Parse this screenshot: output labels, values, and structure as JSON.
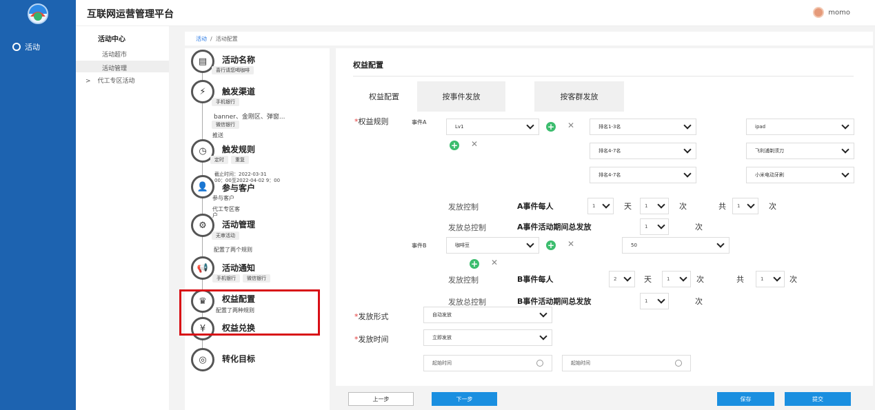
{
  "app": {
    "title": "互联网运营管理平台",
    "user": "momo"
  },
  "left_nav": {
    "active_item": "活动"
  },
  "sub_nav": {
    "header": "活动中心",
    "items": [
      "活动超市",
      "活动管理"
    ],
    "group": "代工专区活动",
    "group_caret": ">"
  },
  "breadcrumb": {
    "root": "活动",
    "sep": "/",
    "current": "活动配置"
  },
  "steps": [
    {
      "title": "活动名称",
      "lines": [
        "喜行请您喝咖啡"
      ]
    },
    {
      "title": "触发渠道",
      "lines": [
        "手机银行",
        "banner、金刚区、弹窗...",
        "微信银行",
        "推送"
      ]
    },
    {
      "title": "触发规则",
      "pills": [
        "定时",
        "重复"
      ],
      "lines": [
        "截止时间：2022-03-31",
        "00：00至2022-04-02 9：00"
      ]
    },
    {
      "title": "参与客户",
      "lines": [
        "参与客户",
        "代工专区客",
        "户"
      ]
    },
    {
      "title": "活动管理",
      "lines": [
        "无审活动",
        "配置了两个规则"
      ]
    },
    {
      "title": "活动通知",
      "pills": [
        "手机银行",
        "微信银行"
      ]
    },
    {
      "title": "权益配置",
      "lines": [
        "配置了两种规则"
      ]
    },
    {
      "title": "权益兑换",
      "lines": []
    },
    {
      "title": "转化目标",
      "lines": []
    }
  ],
  "panel": {
    "title": "权益配置",
    "tab_label": "权益配置",
    "tabs": [
      "按事件发放",
      "按客群发放"
    ],
    "rule_label": "权益规则",
    "event_a": {
      "label": "事件A",
      "level": "Lv1",
      "rows": [
        {
          "rank": "排名1-3名",
          "prize": "ipad"
        },
        {
          "rank": "排名4-7名",
          "prize": "飞利浦剃须刀"
        },
        {
          "rank": "排名4-7名",
          "prize": "小米电动牙刷"
        }
      ],
      "control_label": "发放控制",
      "control_text": "A事件每人",
      "control_n1": "1",
      "day": "天",
      "control_n2": "1",
      "times": "次",
      "total": "共",
      "control_n3": "1",
      "total_label": "发放总控制",
      "total_text": "A事件活动期间总发放",
      "total_n": "1"
    },
    "event_b": {
      "label": "事件B",
      "item": "咖啡豆",
      "qty": "50",
      "control_label": "发放控制",
      "control_text": "B事件每人",
      "control_n1": "2",
      "day": "天",
      "control_n2": "1",
      "times": "次",
      "total": "共",
      "control_n3": "1",
      "total_label": "发放总控制",
      "total_text": "B事件活动期间总发放",
      "total_n": "1"
    },
    "form_label": "发放形式",
    "form_value": "自动发放",
    "time_label": "发放时间",
    "time_value": "立即发放",
    "start_placeholder": "起始时间",
    "end_placeholder": "起始时间",
    "required_mark": "*",
    "remove_glyph": "✕"
  },
  "footer": {
    "prev": "上一步",
    "next": "下一步",
    "save": "保存",
    "submit": "提交"
  },
  "colors": {
    "primary": "#1d63b0",
    "highlight": "#d80e15",
    "add": "#3cbd6e",
    "button": "#1a8fe0"
  }
}
